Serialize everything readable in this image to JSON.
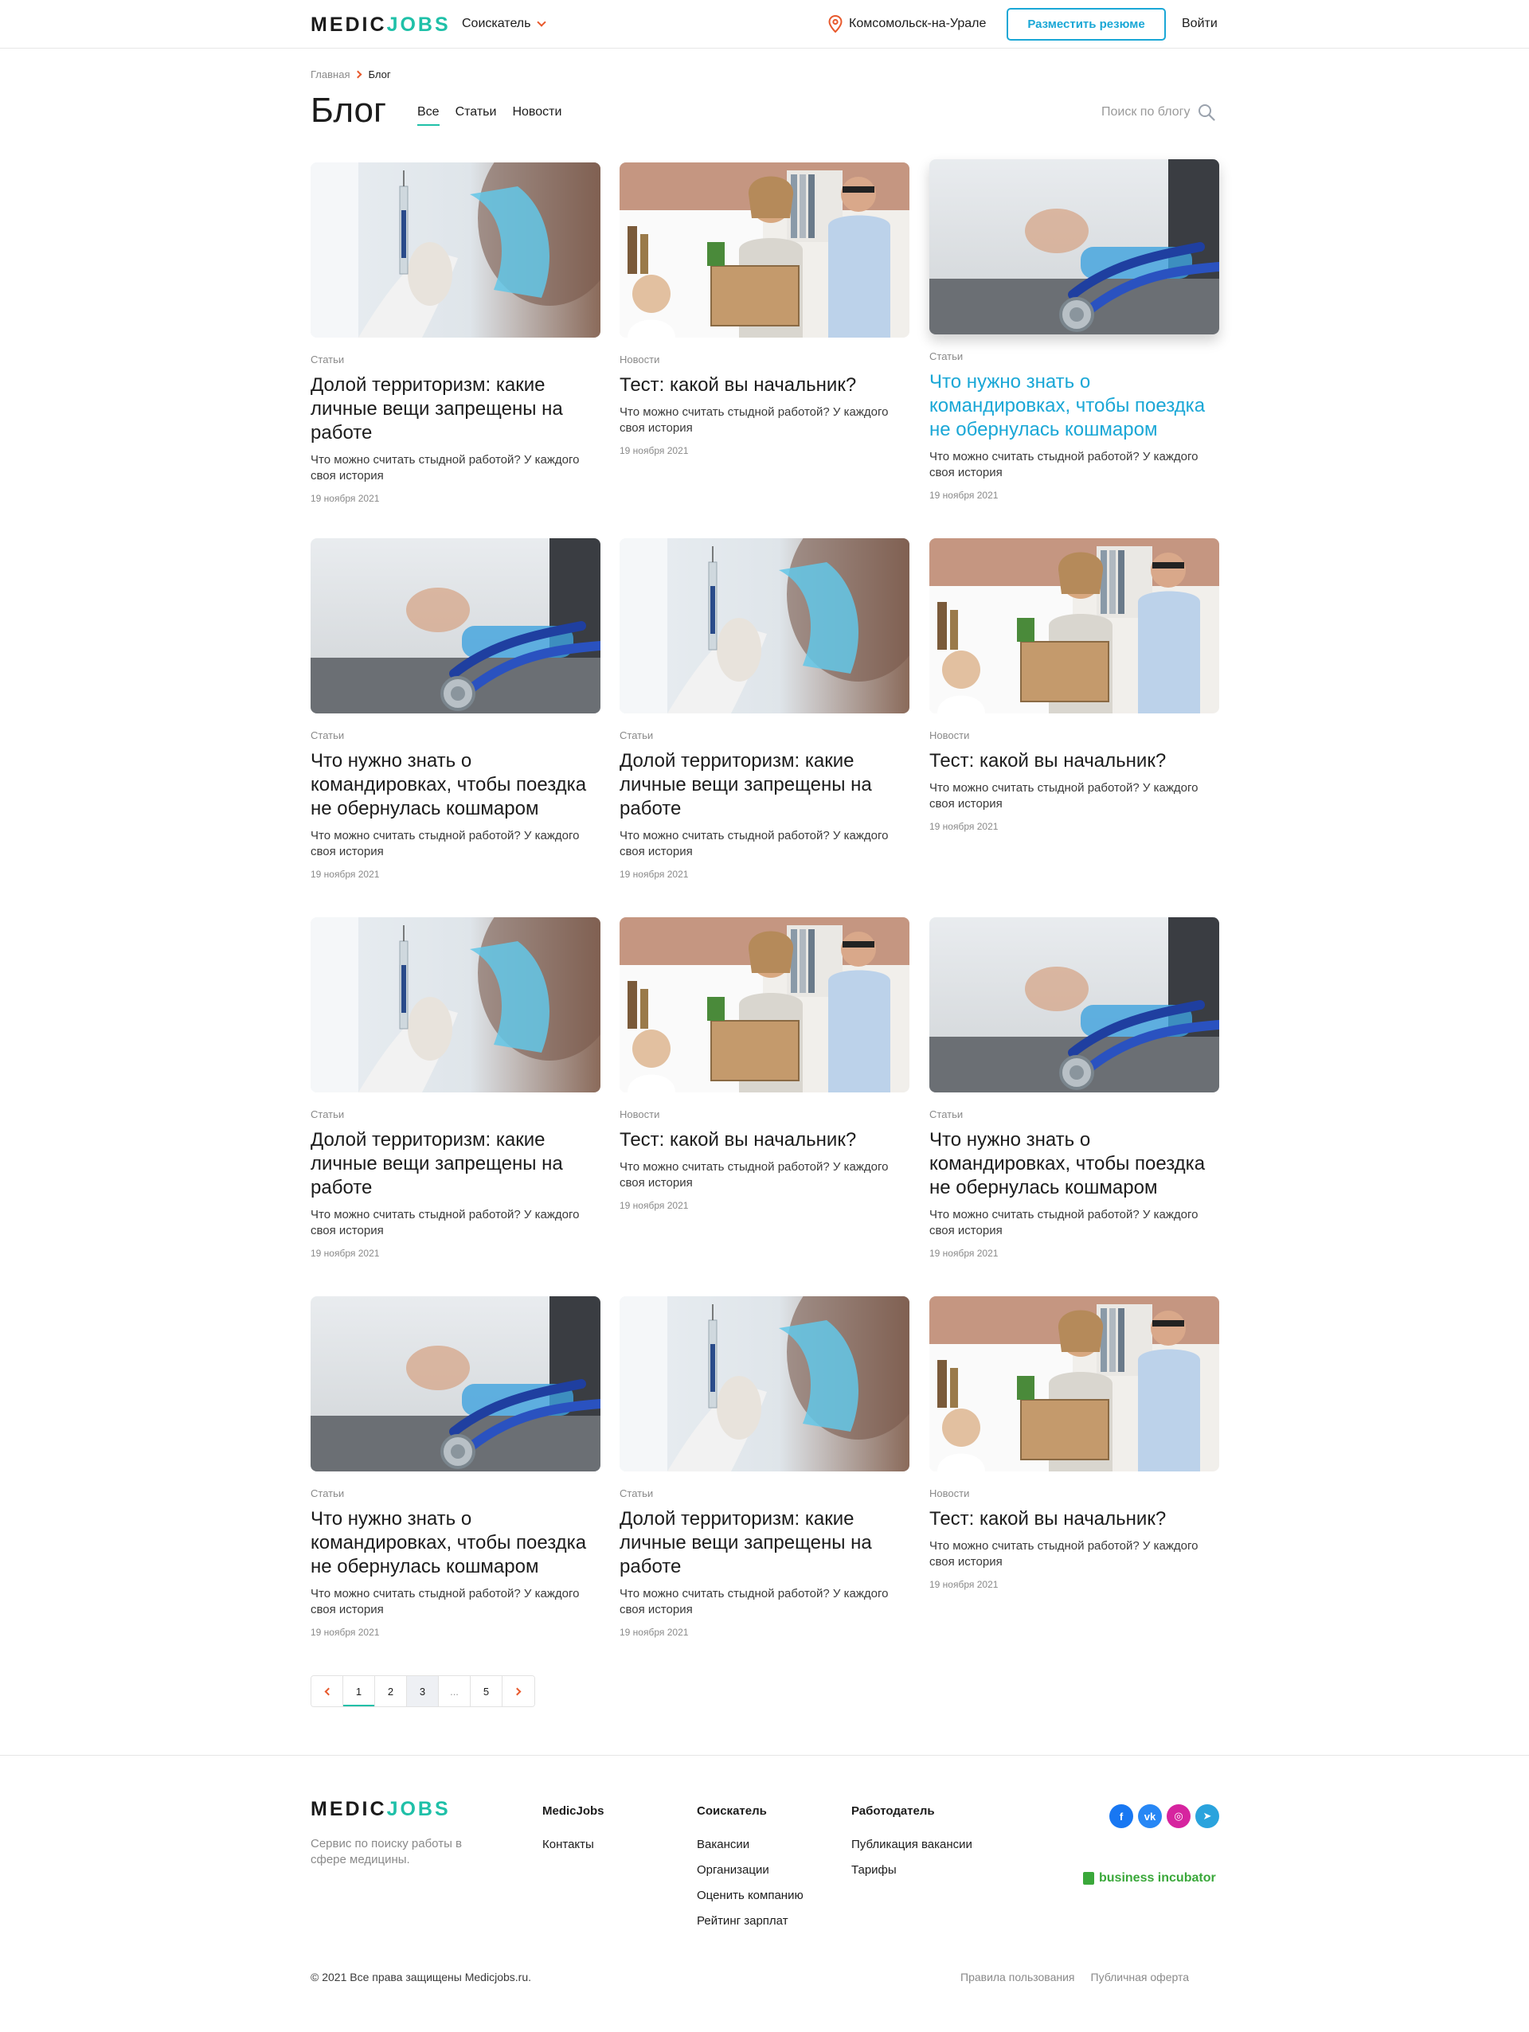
{
  "header": {
    "logo_part1": "MEDIC",
    "logo_part2": "JOBS",
    "role": "Соискатель",
    "city": "Комсомольск-на-Урале",
    "resume_button": "Разместить резюме",
    "login": "Войти"
  },
  "breadcrumb": {
    "home": "Главная",
    "current": "Блог"
  },
  "page": {
    "title": "Блог",
    "tabs": [
      "Все",
      "Статьи",
      "Новости"
    ],
    "search_placeholder": "Поиск по блогу"
  },
  "cards": [
    {
      "category": "Статьи",
      "title": "Долой территоризм: какие личные вещи запрещены на работе",
      "desc": "Что можно считать стыдной работой? У каждого своя история",
      "date": "19 ноября 2021",
      "image": "syringe"
    },
    {
      "category": "Новости",
      "title": "Тест: какой вы начальник?",
      "desc": "Что можно считать стыдной работой? У каждого своя история",
      "date": "19 ноября 2021",
      "image": "office"
    },
    {
      "category": "Статьи",
      "title": "Что нужно знать о командировках, чтобы поездка не обернулась кошмаром",
      "desc": "Что можно считать стыдной работой? У каждого своя история",
      "date": "19 ноября 2021",
      "image": "stethoscope"
    },
    {
      "category": "Статьи",
      "title": "Что нужно знать о командировках, чтобы поездка не обернулась кошмаром",
      "desc": "Что можно считать стыдной работой? У каждого своя история",
      "date": "19 ноября 2021",
      "image": "stethoscope"
    },
    {
      "category": "Статьи",
      "title": "Долой территоризм: какие личные вещи запрещены на работе",
      "desc": "Что можно считать стыдной работой? У каждого своя история",
      "date": "19 ноября 2021",
      "image": "syringe"
    },
    {
      "category": "Новости",
      "title": "Тест: какой вы начальник?",
      "desc": "Что можно считать стыдной работой? У каждого своя история",
      "date": "19 ноября 2021",
      "image": "office"
    },
    {
      "category": "Статьи",
      "title": "Долой территоризм: какие личные вещи запрещены на работе",
      "desc": "Что можно считать стыдной работой? У каждого своя история",
      "date": "19 ноября 2021",
      "image": "syringe"
    },
    {
      "category": "Новости",
      "title": "Тест: какой вы начальник?",
      "desc": "Что можно считать стыдной работой? У каждого своя история",
      "date": "19 ноября 2021",
      "image": "office"
    },
    {
      "category": "Статьи",
      "title": "Что нужно знать о командировках, чтобы поездка не обернулась кошмаром",
      "desc": "Что можно считать стыдной работой? У каждого своя история",
      "date": "19 ноября 2021",
      "image": "stethoscope"
    },
    {
      "category": "Статьи",
      "title": "Что нужно знать о командировках, чтобы поездка не обернулась кошмаром",
      "desc": "Что можно считать стыдной работой? У каждого своя история",
      "date": "19 ноября 2021",
      "image": "stethoscope"
    },
    {
      "category": "Статьи",
      "title": "Долой территоризм: какие личные вещи запрещены на работе",
      "desc": "Что можно считать стыдной работой? У каждого своя история",
      "date": "19 ноября 2021",
      "image": "syringe"
    },
    {
      "category": "Новости",
      "title": "Тест: какой вы начальник?",
      "desc": "Что можно считать стыдной работой? У каждого своя история",
      "date": "19 ноября 2021",
      "image": "office"
    }
  ],
  "pagination": {
    "pages": [
      "1",
      "2",
      "3",
      "...",
      "5"
    ],
    "current": "1",
    "hovered": "3"
  },
  "footer": {
    "logo_part1": "MEDIC",
    "logo_part2": "JOBS",
    "tagline": "Сервис по поиску работы в сфере медицины.",
    "columns": [
      {
        "heading": "MedicJobs",
        "links": [
          "Контакты"
        ]
      },
      {
        "heading": "Соискатель",
        "links": [
          "Вакансии",
          "Организации",
          "Оценить компанию",
          "Рейтинг зарплат"
        ]
      },
      {
        "heading": "Работодатель",
        "links": [
          "Публикация вакансии",
          "Тарифы"
        ]
      }
    ],
    "socials": [
      {
        "icon": "facebook-icon",
        "glyph": "f",
        "color": "#1877f2"
      },
      {
        "icon": "vk-icon",
        "glyph": "vk",
        "color": "#2787f5"
      },
      {
        "icon": "instagram-icon",
        "glyph": "◎",
        "color": "#d6249f"
      },
      {
        "icon": "telegram-icon",
        "glyph": "➤",
        "color": "#2aa3dd"
      }
    ],
    "partner": "business incubator",
    "copyright": "© 2021 Все права защищены Medicjobs.ru.",
    "legal": [
      "Правила пользования",
      "Публичная оферта"
    ]
  },
  "colors": {
    "accent": "#1fc0a8",
    "link": "#1aa7d6",
    "orange": "#e8592c"
  }
}
